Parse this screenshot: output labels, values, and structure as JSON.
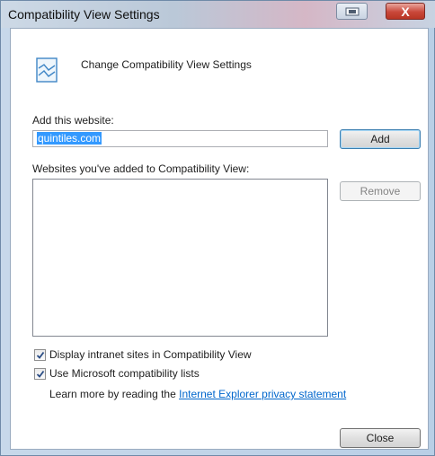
{
  "window": {
    "title": "Compatibility View Settings",
    "close_glyph": "X"
  },
  "header": {
    "text": "Change Compatibility View Settings",
    "icon": "compatibility-view-icon"
  },
  "add_section": {
    "label": "Add this website:",
    "input_value": "quintiles.com",
    "add_button": "Add"
  },
  "list_section": {
    "label": "Websites you've added to Compatibility View:",
    "items": [],
    "remove_button": "Remove"
  },
  "options": {
    "intranet": {
      "label": "Display intranet sites in Compatibility View",
      "checked": true
    },
    "microsoft_lists": {
      "label": "Use Microsoft compatibility lists",
      "checked": true
    },
    "learn_more_prefix": "Learn more by reading the",
    "privacy_link": "Internet Explorer privacy statement"
  },
  "footer": {
    "close_button": "Close"
  },
  "colors": {
    "link": "#0066cc",
    "selection": "#3399ff",
    "close_button": "#c9483a"
  }
}
